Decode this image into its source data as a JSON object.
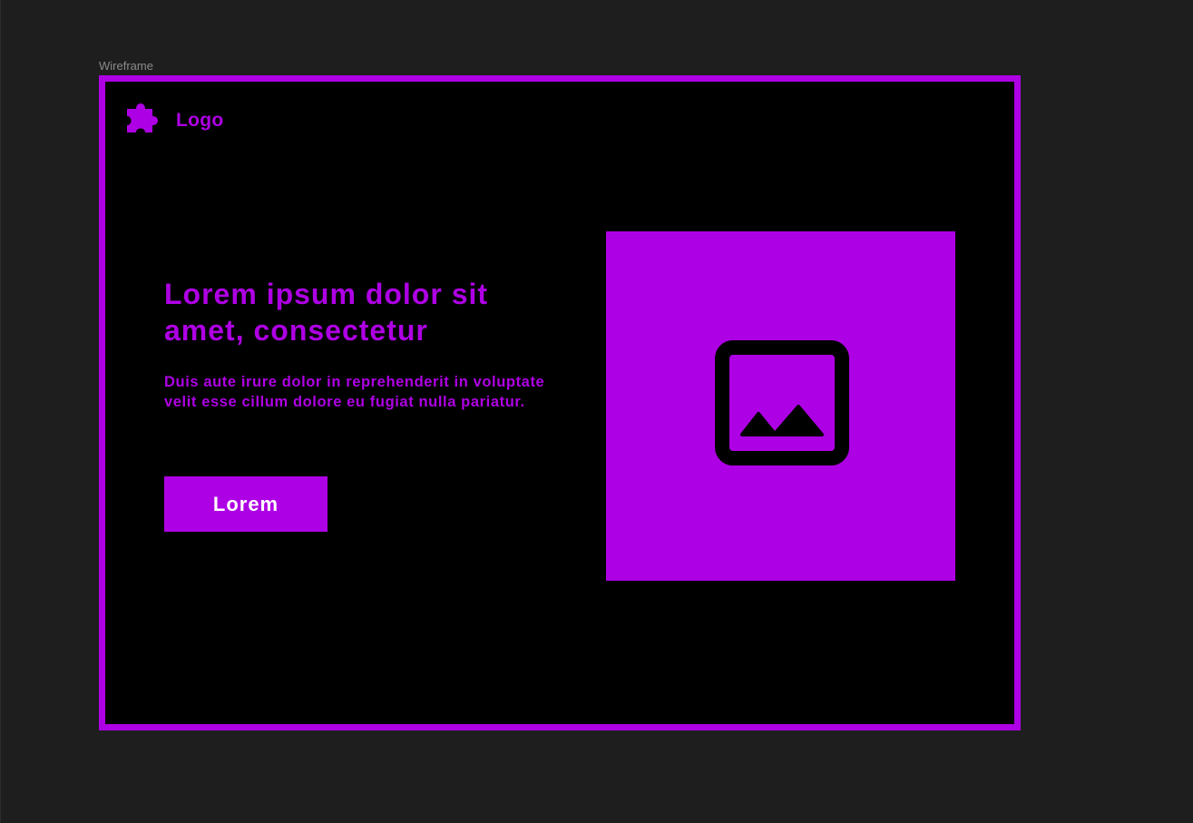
{
  "canvas": {
    "frame_label": "Wireframe"
  },
  "header": {
    "logo_text": "Logo",
    "logo_icon": "puzzle-piece-icon"
  },
  "hero": {
    "headline": "Lorem ipsum dolor sit amet, consectetur",
    "body": "Duis aute irure dolor in reprehenderit in voluptate velit esse cillum dolore eu fugiat nulla pariatur.",
    "cta_label": "Lorem",
    "image_icon": "image-icon"
  },
  "colors": {
    "accent": "#ae00e4",
    "frame_background": "#000000",
    "canvas_background": "#1e1e1e",
    "button_text": "#ffffff"
  }
}
